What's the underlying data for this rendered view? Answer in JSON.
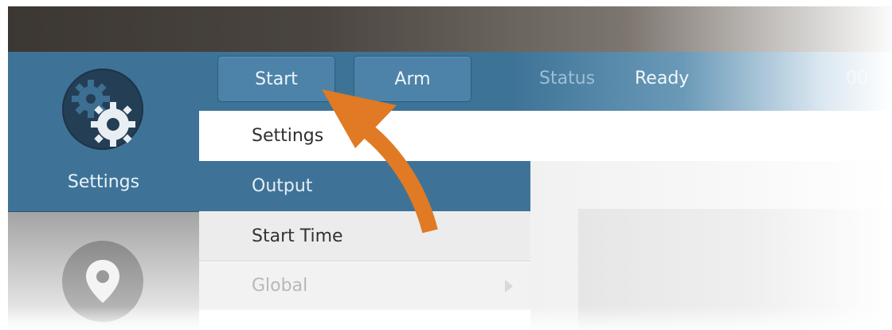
{
  "sidebar": {
    "active_item": {
      "label": "Settings",
      "icon": "gear-icon"
    },
    "next_item": {
      "icon": "map-pin-icon"
    }
  },
  "toolbar": {
    "start_label": "Start",
    "arm_label": "Arm",
    "status_label": "Status",
    "status_value": "Ready",
    "status_extra": "00"
  },
  "menu": {
    "items": [
      {
        "label": "Settings"
      },
      {
        "label": "Output"
      },
      {
        "label": "Start Time"
      },
      {
        "label": "Global"
      }
    ]
  },
  "annotation": {
    "color": "#e07a24"
  },
  "colors": {
    "accent_blue": "#3e7397",
    "dark_title": "#3c3733"
  }
}
